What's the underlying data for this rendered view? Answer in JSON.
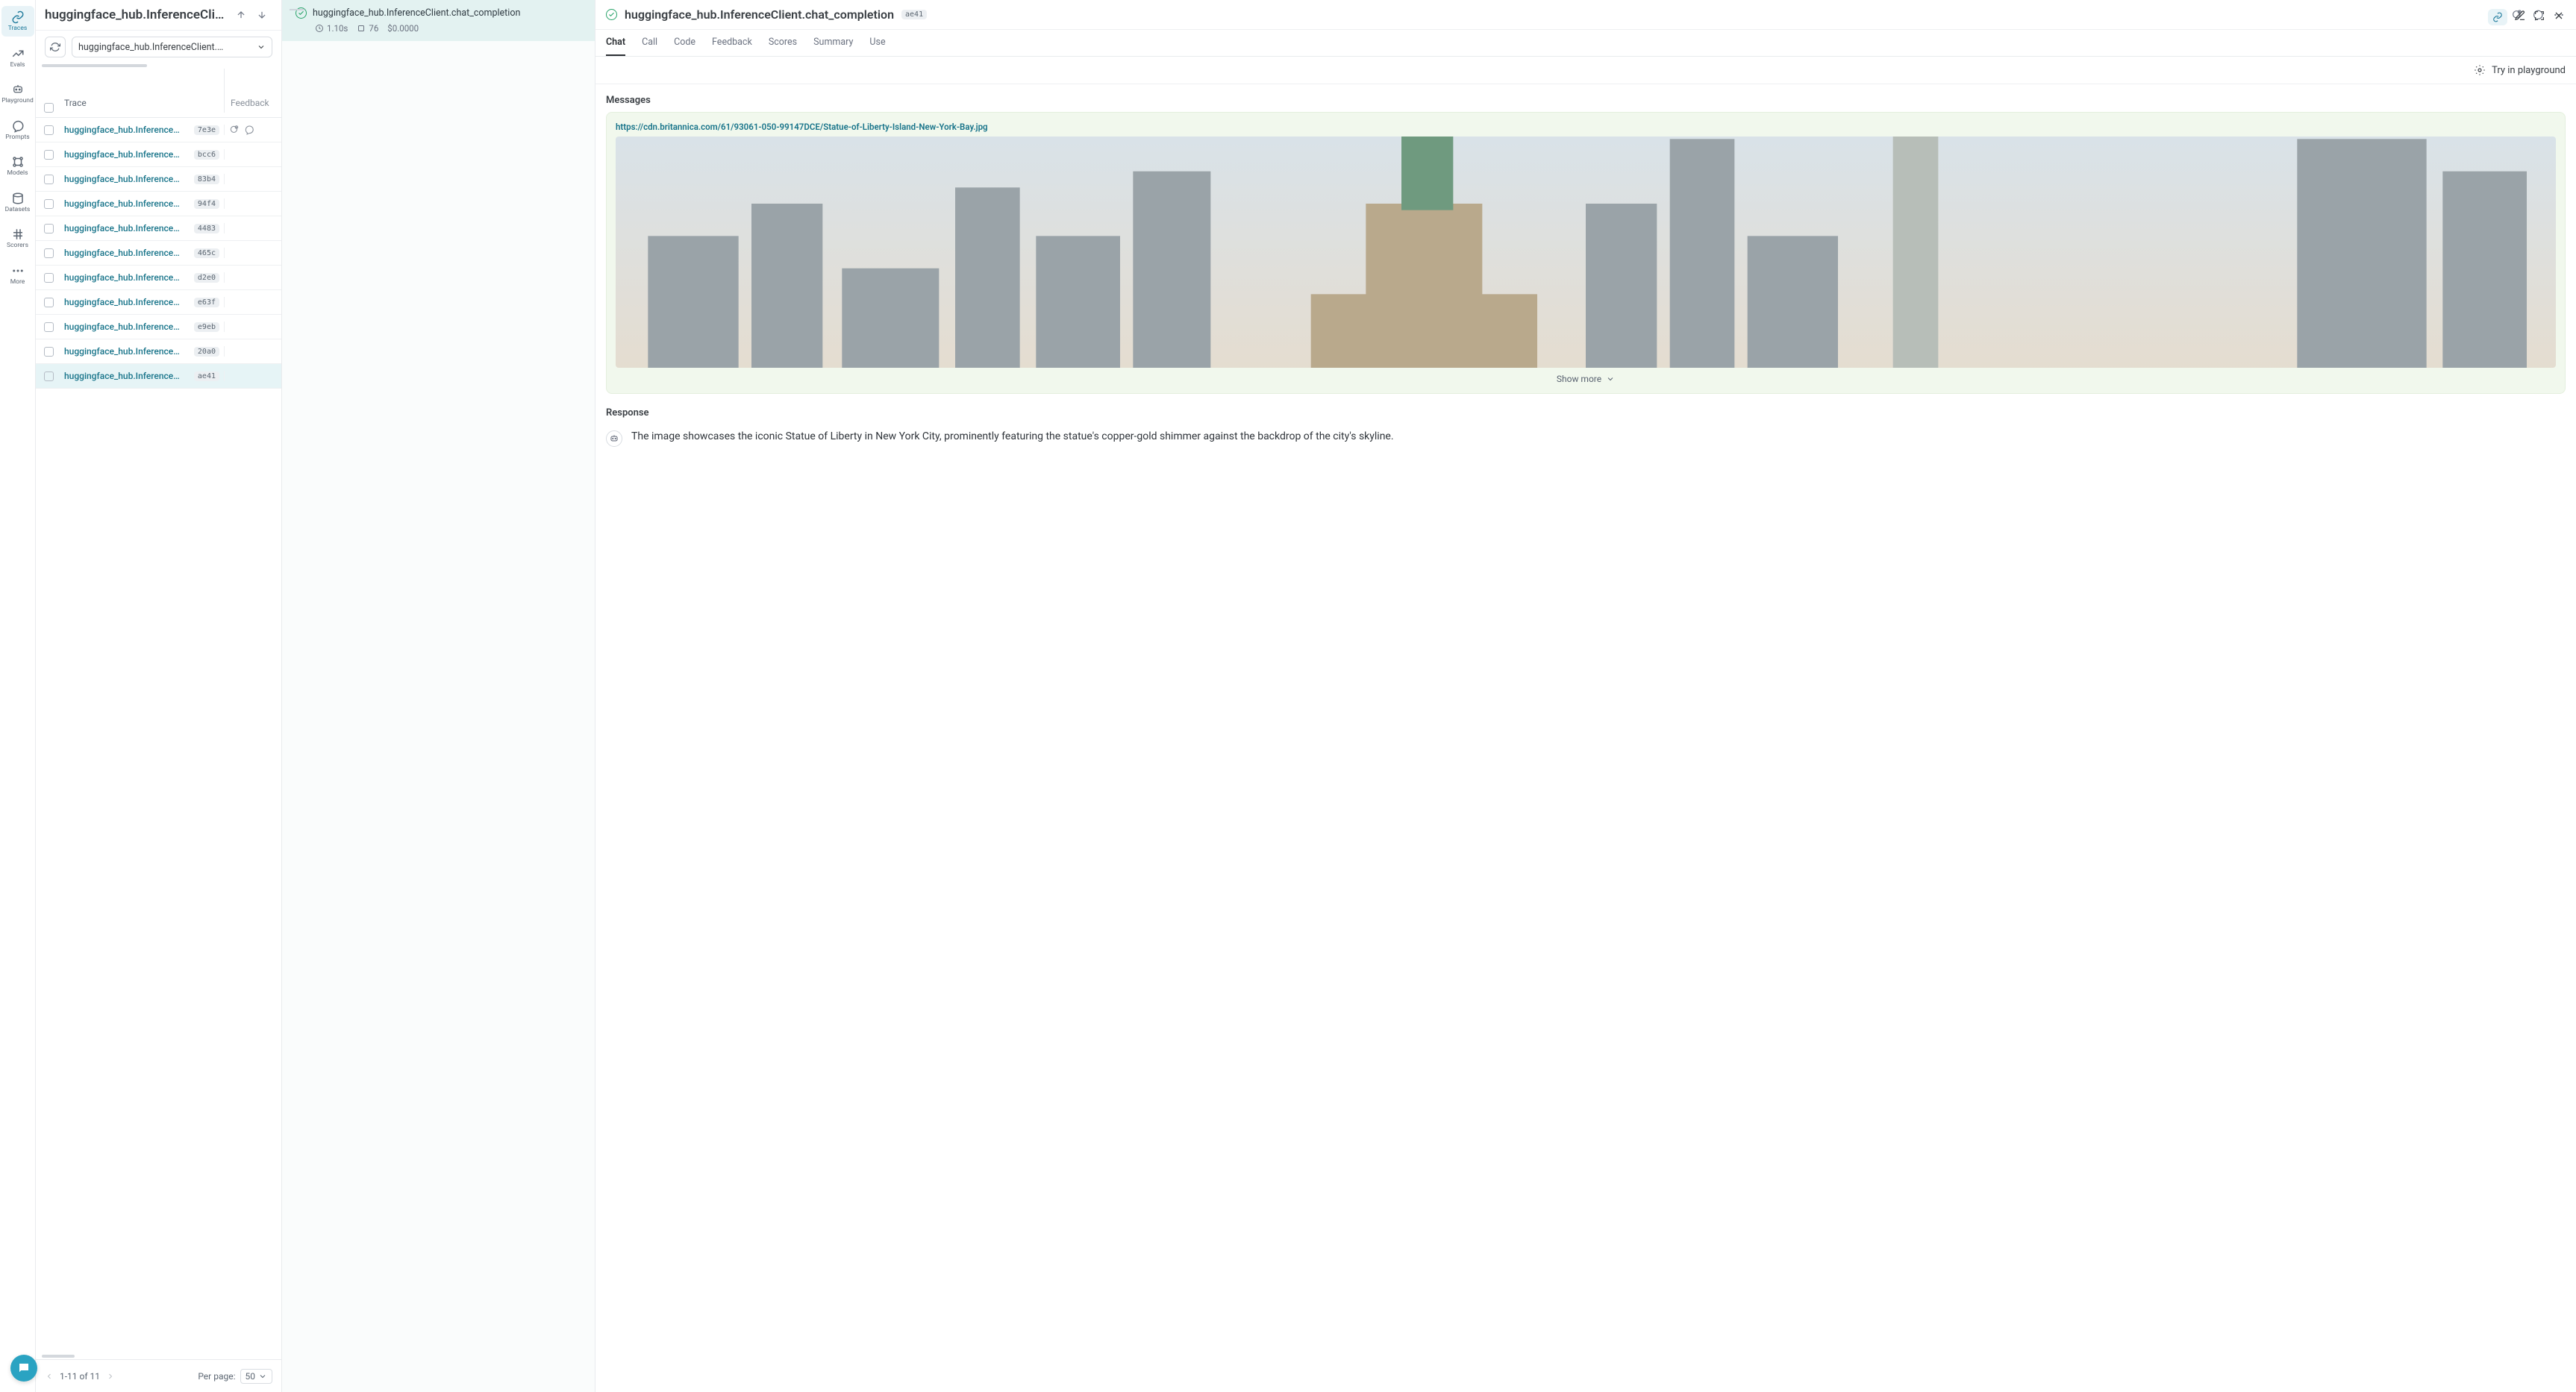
{
  "sidenav": [
    {
      "key": "traces",
      "label": "Traces",
      "active": true
    },
    {
      "key": "evals",
      "label": "Evals"
    },
    {
      "key": "playground",
      "label": "Playground"
    },
    {
      "key": "prompts",
      "label": "Prompts"
    },
    {
      "key": "models",
      "label": "Models"
    },
    {
      "key": "datasets",
      "label": "Datasets"
    },
    {
      "key": "scorers",
      "label": "Scorers"
    },
    {
      "key": "more",
      "label": "More"
    }
  ],
  "left": {
    "title": "huggingface_hub.InferenceClient.chat_cc",
    "dropdown": "huggingface_hub.InferenceClient.c…",
    "columns": {
      "trace": "Trace",
      "feedback": "Feedback"
    },
    "rows": [
      {
        "name": "huggingface_hub.Inference…",
        "hash": "7e3e",
        "fb": true
      },
      {
        "name": "huggingface_hub.Inference…",
        "hash": "bcc6"
      },
      {
        "name": "huggingface_hub.Inference…",
        "hash": "83b4"
      },
      {
        "name": "huggingface_hub.Inference…",
        "hash": "94f4"
      },
      {
        "name": "huggingface_hub.Inference…",
        "hash": "4483"
      },
      {
        "name": "huggingface_hub.Inference…",
        "hash": "465c"
      },
      {
        "name": "huggingface_hub.Inference…",
        "hash": "d2e0"
      },
      {
        "name": "huggingface_hub.Inference…",
        "hash": "e63f"
      },
      {
        "name": "huggingface_hub.Inference…",
        "hash": "e9eb"
      },
      {
        "name": "huggingface_hub.Inference…",
        "hash": "20a0"
      },
      {
        "name": "huggingface_hub.Inference…",
        "hash": "ae41",
        "selected": true
      }
    ],
    "pager": {
      "range": "1-11 of 11",
      "per_page_label": "Per page:",
      "per_page_value": "50"
    }
  },
  "middle": {
    "name": "huggingface_hub.InferenceClient.chat_completion",
    "latency": "1.10s",
    "tokens": "76",
    "cost": "$0.0000"
  },
  "right": {
    "title": "huggingface_hub.InferenceClient.chat_completion",
    "hash": "ae41",
    "tabs": [
      "Chat",
      "Call",
      "Code",
      "Feedback",
      "Scores",
      "Summary",
      "Use"
    ],
    "active_tab": "Chat",
    "playground": "Try in playground",
    "messages_h": "Messages",
    "msg_url": "https://cdn.britannica.com/61/93061-050-99147DCE/Statue-of-Liberty-Island-New-York-Bay.jpg",
    "show_more": "Show more",
    "response_h": "Response",
    "response_text": "The image showcases the iconic Statue of Liberty in New York City, prominently featuring the statue's copper-gold shimmer against the backdrop of the city's skyline."
  }
}
